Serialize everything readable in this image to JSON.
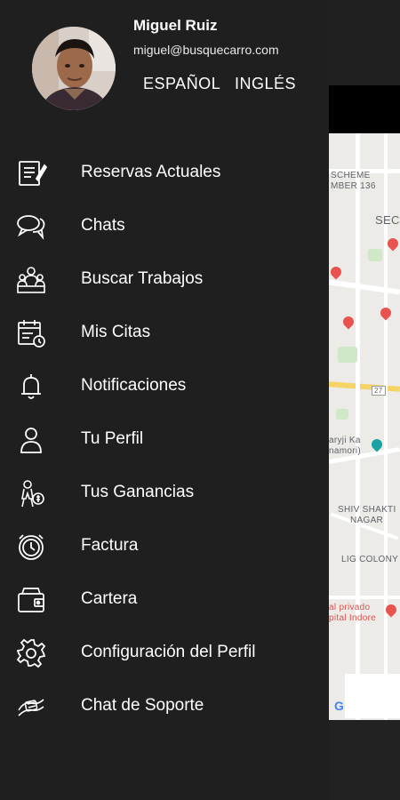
{
  "user": {
    "name": "Miguel Ruiz",
    "email": "miguel@busquecarro.com"
  },
  "languages": {
    "spanish": "ESPAÑOL",
    "english": "INGLÉS"
  },
  "menu": [
    {
      "label": "Reservas Actuales",
      "icon": "reservations-icon"
    },
    {
      "label": "Chats",
      "icon": "chat-icon"
    },
    {
      "label": "Buscar Trabajos",
      "icon": "jobs-icon"
    },
    {
      "label": "Mis Citas",
      "icon": "calendar-icon"
    },
    {
      "label": "Notificaciones",
      "icon": "bell-icon"
    },
    {
      "label": "Tu Perfil",
      "icon": "user-icon"
    },
    {
      "label": "Tus Ganancias",
      "icon": "earnings-icon"
    },
    {
      "label": "Factura",
      "icon": "invoice-icon"
    },
    {
      "label": "Cartera",
      "icon": "wallet-icon"
    },
    {
      "label": "Configuración del Perfil",
      "icon": "gear-icon"
    },
    {
      "label": "Chat de Soporte",
      "icon": "support-icon"
    }
  ],
  "map": {
    "labels": {
      "scheme": "SCHEME",
      "number": "MBER 136",
      "sector": "SEC",
      "road": "27",
      "aryji": "aryji Ka",
      "namori": "namori)",
      "shiv": "SHIV SHAKTI",
      "nagar": "NAGAR",
      "lig": "LIG COLONY",
      "privado": "al privado",
      "indore": "pital Indore"
    },
    "logo": "G"
  }
}
